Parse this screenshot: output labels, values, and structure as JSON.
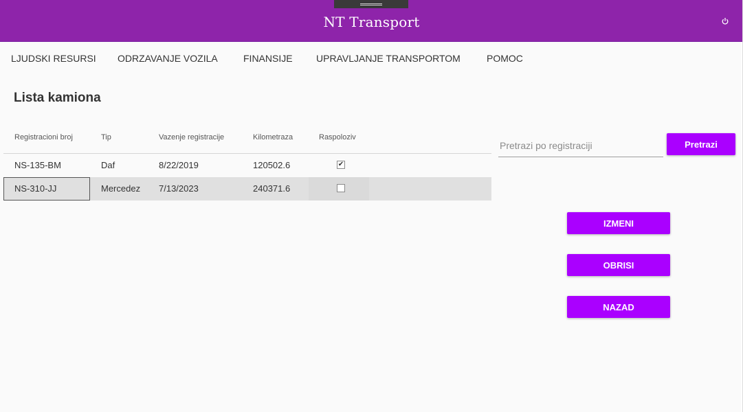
{
  "app": {
    "title": "NT Transport",
    "power_icon": "power-icon",
    "accent": "#8e24aa",
    "button_color": "#aa00ff"
  },
  "menu": {
    "items": [
      {
        "label": "LJUDSKI RESURSI"
      },
      {
        "label": "ODRZAVANJE VOZILA"
      },
      {
        "label": "FINANSIJE"
      },
      {
        "label": "UPRAVLJANJE TRANSPORTOM"
      },
      {
        "label": "POMOC"
      }
    ]
  },
  "page": {
    "title": "Lista kamiona"
  },
  "table": {
    "columns": [
      "Registracioni broj",
      "Tip",
      "Vazenje registracije",
      "Kilometraza",
      "Raspoloziv"
    ],
    "rows": [
      {
        "reg": "NS-135-BM",
        "tip": "Daf",
        "vazenje": "8/22/2019",
        "km": "120502.6",
        "raspoloziv": true
      },
      {
        "reg": "NS-310-JJ",
        "tip": "Mercedez",
        "vazenje": "7/13/2023",
        "km": "240371.6",
        "raspoloziv": false
      }
    ],
    "selected_row": 1
  },
  "search": {
    "placeholder": "Pretrazi po registraciji",
    "value": "",
    "button_label": "Pretrazi"
  },
  "actions": {
    "edit_label": "IZMENI",
    "delete_label": "OBRISI",
    "back_label": "NAZAD"
  }
}
